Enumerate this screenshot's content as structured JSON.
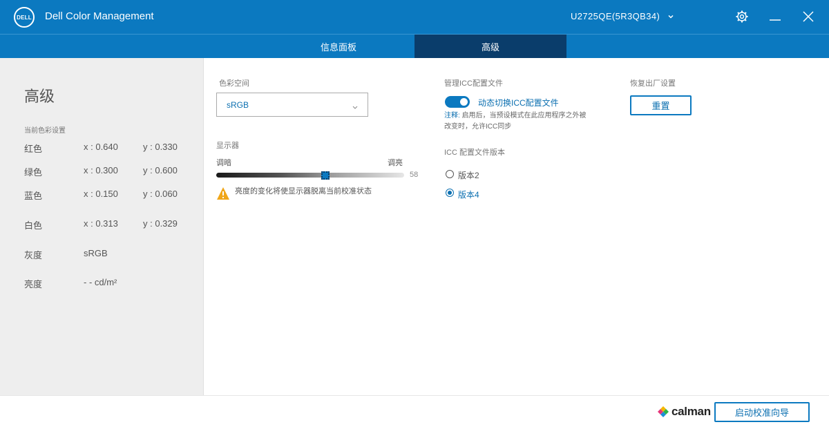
{
  "app": {
    "logo_text": "DELL",
    "title": "Dell Color Management",
    "monitor": "U2725QE(5R3QB34)",
    "icons": {
      "settings": "gear-icon",
      "minimize": "minimize-icon",
      "close": "close-icon",
      "dropdown": "chevron-down-icon"
    }
  },
  "tabs": [
    {
      "label": "信息面板",
      "active": false
    },
    {
      "label": "高级",
      "active": true
    }
  ],
  "left_panel": {
    "title": "高级",
    "section_label": "当前色彩设置",
    "rows": [
      {
        "label": "红色",
        "x": "x : 0.640",
        "y": "y : 0.330"
      },
      {
        "label": "绿色",
        "x": "x : 0.300",
        "y": "y : 0.600"
      },
      {
        "label": "蓝色",
        "x": "x : 0.150",
        "y": "y : 0.060"
      },
      {
        "label": "白色",
        "x": "x : 0.313",
        "y": "y : 0.329"
      },
      {
        "label": "灰度",
        "x": "sRGB",
        "y": ""
      },
      {
        "label": "亮度",
        "x": "- -   cd/m²",
        "y": ""
      }
    ]
  },
  "color_space": {
    "caption": "色彩空间",
    "selected": "sRGB"
  },
  "display": {
    "caption": "显示器",
    "dim_label": "调暗",
    "bright_label": "调亮",
    "brightness": 58,
    "brightness_max": 100,
    "warning": "亮度的变化将使显示器脱离当前校准状态"
  },
  "icc": {
    "caption": "管理ICC配置文件",
    "toggle_on": true,
    "toggle_label": "动态切换ICC配置文件",
    "note_prefix": "注释:",
    "note": "启用后，当预设模式在此应用程序之外被改变时，允许ICC同步",
    "version_caption": "ICC 配置文件版本",
    "versions": [
      {
        "label": "版本2",
        "selected": false
      },
      {
        "label": "版本4",
        "selected": true
      }
    ]
  },
  "factory": {
    "caption": "恢复出厂设置",
    "button": "重置"
  },
  "footer": {
    "brand": "calman",
    "wizard_button": "启动校准向导"
  },
  "colors": {
    "accent": "#0b79c0",
    "active_tab": "#0a3d6b",
    "left_bg": "#eeeeee"
  }
}
